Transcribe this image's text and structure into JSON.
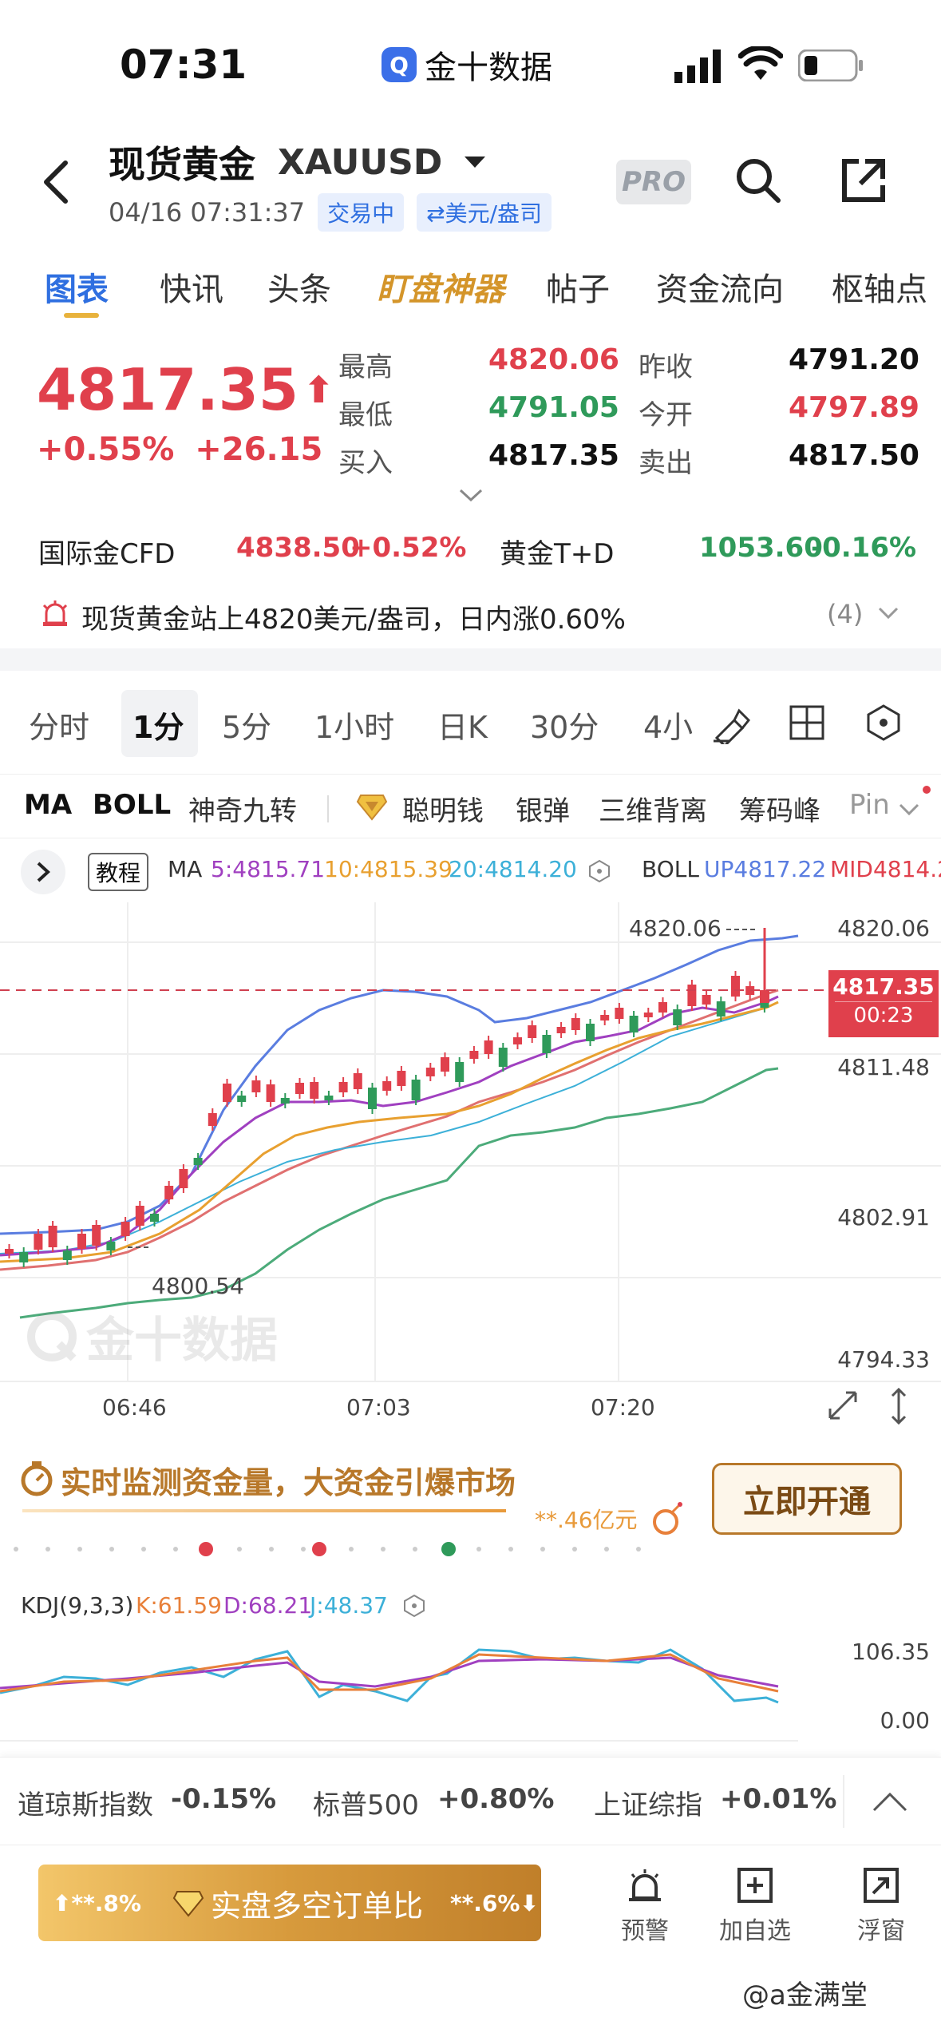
{
  "status": {
    "time": "07:31",
    "app_name": "金十数据"
  },
  "header": {
    "title": "现货黄金",
    "symbol": "XAUUSD",
    "datetime": "04/16 07:31:37",
    "trade_status": "交易中",
    "unit": "⇄美元/盎司",
    "pro": "PRO"
  },
  "tabs": [
    "图表",
    "快讯",
    "头条",
    "盯盘神器",
    "帖子",
    "资金流向",
    "枢轴点"
  ],
  "quote": {
    "price": "4817.35",
    "arrow": "⬆",
    "change_pct": "+0.55%",
    "change": "+26.15",
    "high_label": "最高",
    "high": "4820.06",
    "low_label": "最低",
    "low": "4791.05",
    "bid_label": "买入",
    "bid": "4817.35",
    "prev_label": "昨收",
    "prev": "4791.20",
    "open_label": "今开",
    "open": "4797.89",
    "ask_label": "卖出",
    "ask": "4817.50"
  },
  "cfd": {
    "name1": "国际金CFD",
    "price1": "4838.50",
    "pct1": "+0.52%",
    "name2": "黄金T+D",
    "price2": "1053.60",
    "pct2": "-0.16%"
  },
  "news": {
    "text": "现货黄金站上4820美元/盎司，日内涨0.60%",
    "count": "(4)"
  },
  "periods": [
    "分时",
    "1分",
    "5分",
    "1小时",
    "日K",
    "30分",
    "4小"
  ],
  "indicators": [
    "MA",
    "BOLL",
    "神奇九转",
    "聪明钱",
    "银弹",
    "三维背离",
    "筹码峰",
    "Pin"
  ],
  "chart": {
    "tutorial": "教程",
    "ma_label": "MA",
    "ma5": "5:4815.71",
    "ma10": "10:4815.39",
    "ma20": "20:4814.20",
    "boll_label": "BOLL",
    "boll_up": "UP4817.22",
    "boll_mid": "MID4814.2",
    "y_labels": [
      "4820.06",
      "4811.48",
      "4802.91",
      "4794.33"
    ],
    "high_mark": "4820.06",
    "low_mark": "4800.54",
    "cur_price": "4817.35",
    "countdown": "00:23",
    "x_labels": [
      "06:46",
      "07:03",
      "07:20"
    ],
    "watermark": "金十数据"
  },
  "promo": {
    "text": "实时监测资金量，大资金引爆市场",
    "amount": "**.46亿元",
    "button": "立即开通"
  },
  "kdj": {
    "label": "KDJ(9,3,3)",
    "k": "K:61.59",
    "d": "D:68.21",
    "j": "J:48.37",
    "y_top": "106.35",
    "y_bottom": "0.00"
  },
  "ticker": [
    {
      "name": "道琼斯指数",
      "pct": "-0.15%"
    },
    {
      "name": "标普500",
      "pct": "+0.80%"
    },
    {
      "name": "上证综指",
      "pct": "+0.01%"
    }
  ],
  "bottom": {
    "left_pct": "⬆**.8%",
    "mid": "实盘多空订单比",
    "right_pct": "**.6%⬇",
    "alert": "预警",
    "watch": "加自选",
    "float": "浮窗"
  },
  "watermark_text": "@a金满堂",
  "colors": {
    "up": "#e0404c",
    "down": "#2f9a5a",
    "accent": "#2f6fe0",
    "gold": "#c8892e"
  }
}
